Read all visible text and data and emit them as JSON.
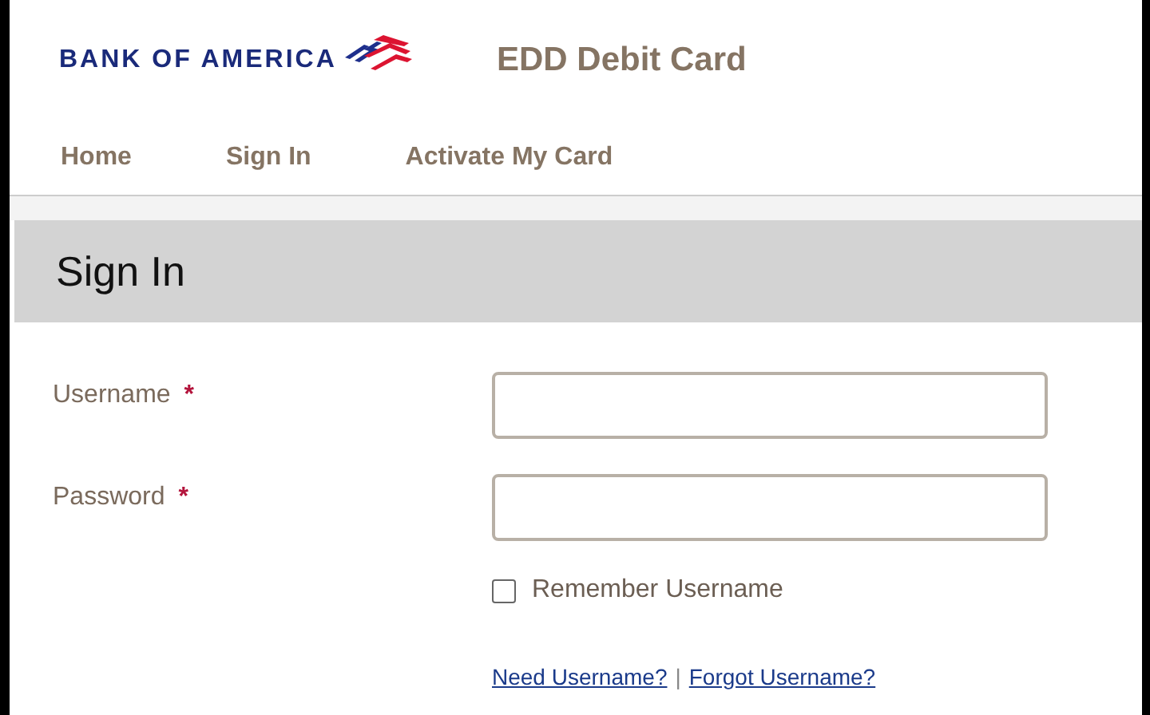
{
  "header": {
    "logo_text": "BANK OF AMERICA",
    "title": "EDD Debit Card"
  },
  "nav": [
    {
      "label": "Home"
    },
    {
      "label": "Sign In"
    },
    {
      "label": "Activate My Card"
    }
  ],
  "page_title": "Sign In",
  "fields": [
    {
      "label": "Username",
      "required_mark": "*"
    },
    {
      "label": "Password",
      "required_mark": "*"
    }
  ],
  "remember": {
    "label": "Remember Username",
    "checked": false
  },
  "links": {
    "items": [
      "Need Username?",
      "Forgot Username?"
    ],
    "separator": "|"
  }
}
